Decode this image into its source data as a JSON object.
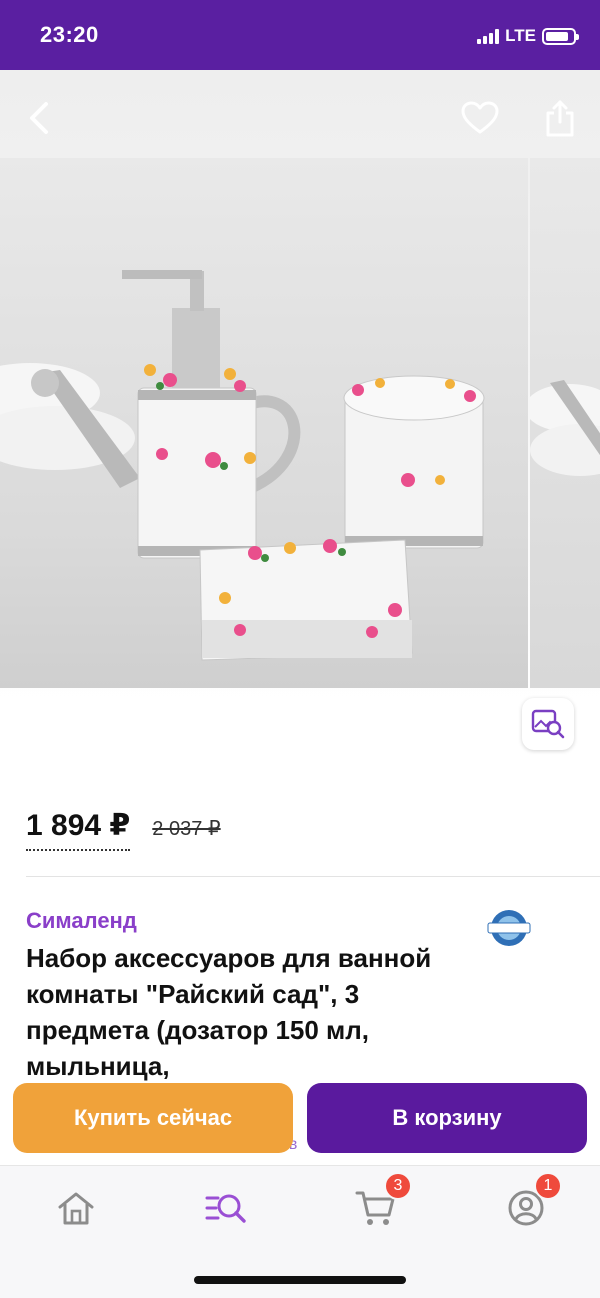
{
  "status_bar": {
    "time": "23:20",
    "network": "LTE"
  },
  "product": {
    "price_current": "1 894 ₽",
    "price_old": "2 037 ₽",
    "seller": "Сималенд",
    "title": "Набор аксессуаров для ванной комнаты \"Райский сад\", 3 предмета (дозатор 150 мл, мыльница,",
    "peek_text": "ов"
  },
  "actions": {
    "buy_now": "Купить сейчас",
    "add_to_cart": "В корзину"
  },
  "tab_bar": {
    "cart_badge": "3",
    "profile_badge": "1"
  },
  "colors": {
    "brand": "#5a1fa1",
    "accent_orange": "#f0a23a",
    "seller": "#8a3fc9",
    "badge": "#ef4a3c"
  },
  "icons": [
    "back-arrow-icon",
    "heart-icon",
    "share-icon",
    "image-search-icon",
    "home-icon",
    "catalog-search-icon",
    "cart-icon",
    "profile-icon"
  ]
}
